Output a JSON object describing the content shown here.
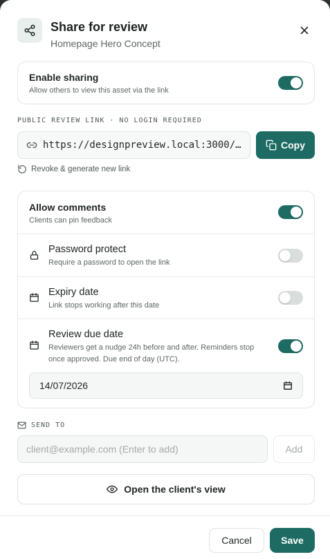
{
  "header": {
    "title": "Share for review",
    "subtitle": "Homepage Hero Concept"
  },
  "sharing": {
    "title": "Enable sharing",
    "desc": "Allow others to view this asset via the link",
    "enabled": true
  },
  "link": {
    "label": "PUBLIC REVIEW LINK · NO LOGIN REQUIRED",
    "url": "https://designpreview.local:3000/…",
    "copy_label": "Copy",
    "revoke_label": "Revoke & generate new link"
  },
  "settings": {
    "comments": {
      "title": "Allow comments",
      "desc": "Clients can pin feedback",
      "enabled": true
    },
    "password": {
      "title": "Password protect",
      "desc": "Require a password to open the link",
      "enabled": false
    },
    "expiry": {
      "title": "Expiry date",
      "desc": "Link stops working after this date",
      "enabled": false
    },
    "due": {
      "title": "Review due date",
      "desc_line1": "Reviewers get a nudge 24h before and after. Reminders stop",
      "desc_line2": "once approved. Due end of day (UTC).",
      "enabled": true,
      "date_value": "14/07/2026"
    }
  },
  "send": {
    "label": "SEND TO",
    "placeholder": "client@example.com (Enter to add)",
    "add_label": "Add"
  },
  "open_view_label": "Open the client's view",
  "footer": {
    "cancel_label": "Cancel",
    "save_label": "Save"
  },
  "colors": {
    "accent": "#1d6b63",
    "toggle_off": "#d9dddc"
  }
}
